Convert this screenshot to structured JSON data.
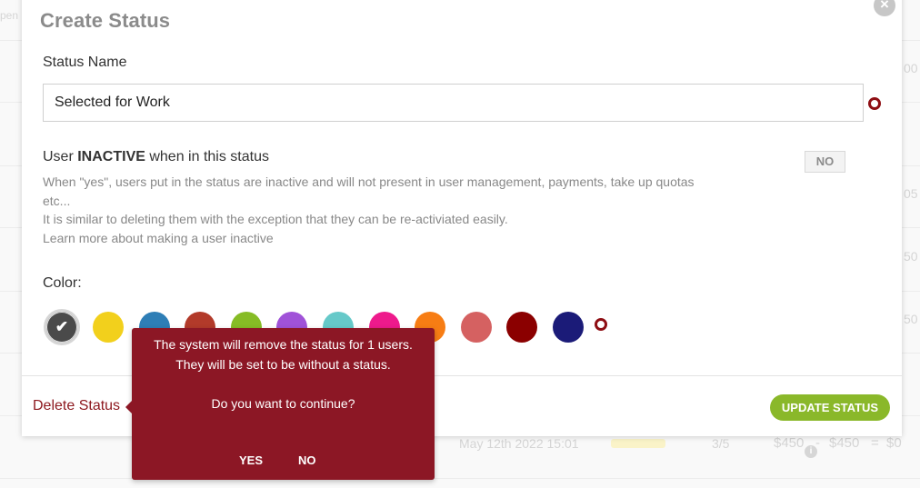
{
  "background": {
    "row_texts": [
      {
        "text": "pen"
      },
      {
        "text": "00"
      },
      {
        "text": "05"
      },
      {
        "text": "50"
      },
      {
        "text": "50"
      }
    ],
    "bottom_row": {
      "date": "May 12th 2022 15:01",
      "count": "3/5",
      "price_a": "$450",
      "minus": "-",
      "price_b": "$450",
      "equals": "=",
      "total": "$0"
    }
  },
  "modal": {
    "title": "Create Status",
    "close_icon": "close-icon",
    "status_name": {
      "label": "Status Name",
      "value": "Selected for Work"
    },
    "inactive": {
      "title_prefix": "User ",
      "title_bold": "INACTIVE",
      "title_suffix": " when in this status",
      "toggle_label": "NO",
      "description_lines": [
        "When \"yes\", users put in the status are inactive and will not present in user management, payments, take up quotas",
        "etc...",
        "It is similar to deleting them with the exception that they can be re-activiated easily.",
        "Learn more about making a user inactive"
      ]
    },
    "color": {
      "label": "Color:",
      "selected_index": 0,
      "swatches": [
        "#4a4a4a",
        "#f2d01c",
        "#2e7eb6",
        "#b23a2a",
        "#86bc25",
        "#a052d8",
        "#66c9c9",
        "#ee1a8c",
        "#f77d14",
        "#d56161",
        "#8b0000",
        "#1b1b78"
      ]
    },
    "footer": {
      "delete_label": "Delete Status",
      "update_label": "UPDATE STATUS"
    }
  },
  "confirm_popover": {
    "line1": "The system will remove the status for 1 users.",
    "line2": "They will be set to be without a status.",
    "question": "Do you want to continue?",
    "yes_label": "YES",
    "no_label": "NO"
  },
  "colors": {
    "accent_red": "#8c1725",
    "update_green": "#8ab82a",
    "required_marker": "#8e0e13"
  }
}
